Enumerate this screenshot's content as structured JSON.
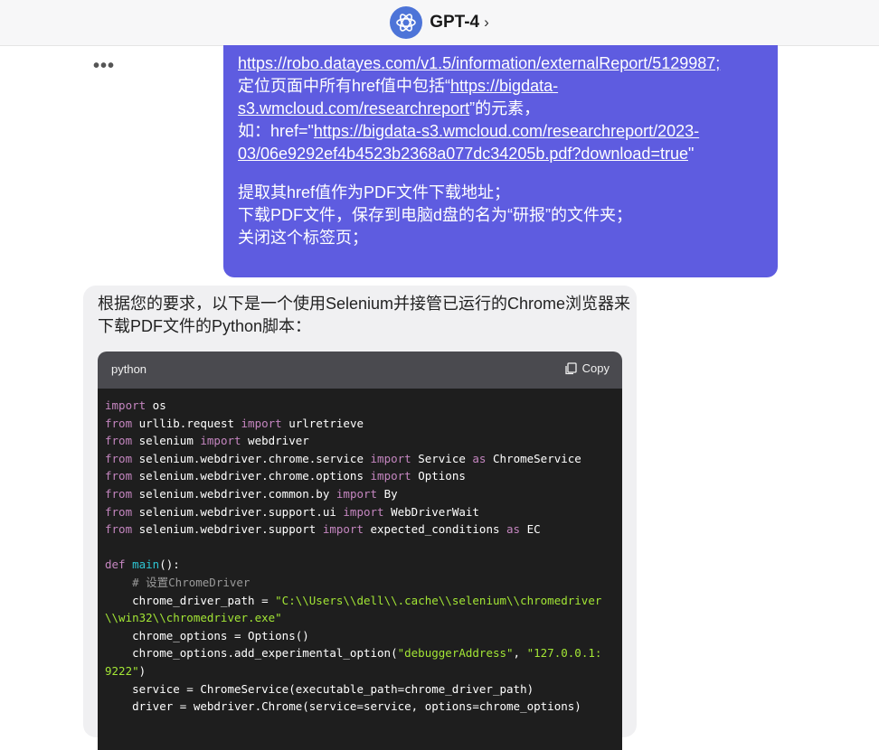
{
  "header": {
    "title": "GPT-4",
    "chevron": "›"
  },
  "more_dots": "•••",
  "user_message": {
    "line1": "https://robo.datayes.com/v1.5/information/externalReport/5129987;",
    "line2_prefix": "定位页面中所有href值中包括“",
    "line2_link": "https://bigdata-s3.wmcloud.com/researchreport",
    "line2_suffix": "”的元素，",
    "line3_prefix": "如：href=\"",
    "line3_link": "https://bigdata-s3.wmcloud.com/researchreport/2023-03/06e9292ef4b4523b2368a077dc34205b.pdf?download=true",
    "line3_suffix": "\"",
    "line4": "提取其href值作为PDF文件下载地址；",
    "line5": "下载PDF文件，保存到电脑d盘的名为“研报”的文件夹；",
    "line6": "关闭这个标签页；"
  },
  "assistant": {
    "intro": "根据您的要求，以下是一个使用Selenium并接管已运行的Chrome浏览器来下载PDF文件的Python脚本：",
    "code_lang": "python",
    "copy_label": "Copy"
  },
  "code": {
    "l1a": "import",
    "l1b": " os",
    "l2a": "from",
    "l2b": " urllib.request ",
    "l2c": "import",
    "l2d": " urlretrieve",
    "l3a": "from",
    "l3b": " selenium ",
    "l3c": "import",
    "l3d": " webdriver",
    "l4a": "from",
    "l4b": " selenium.webdriver.chrome.service ",
    "l4c": "import",
    "l4d": " Service ",
    "l4e": "as",
    "l4f": " ChromeService",
    "l5a": "from",
    "l5b": " selenium.webdriver.chrome.options ",
    "l5c": "import",
    "l5d": " Options",
    "l6a": "from",
    "l6b": " selenium.webdriver.common.by ",
    "l6c": "import",
    "l6d": " By",
    "l7a": "from",
    "l7b": " selenium.webdriver.support.ui ",
    "l7c": "import",
    "l7d": " WebDriverWait",
    "l8a": "from",
    "l8b": " selenium.webdriver.support ",
    "l8c": "import",
    "l8d": " expected_conditions ",
    "l8e": "as",
    "l8f": " EC",
    "l10a": "def",
    "l10b": " main",
    "l10c": "():",
    "l11": "    # 设置ChromeDriver",
    "l12a": "    chrome_driver_path = ",
    "l12b": "\"C:\\\\Users\\\\dell\\\\.cache\\\\selenium\\\\chromedriver",
    "l13": "\\\\win32\\\\chromedriver.exe\"",
    "l14": "    chrome_options = Options()",
    "l15a": "    chrome_options.add_experimental_option(",
    "l15b": "\"debuggerAddress\"",
    "l15c": ", ",
    "l15d": "\"127.0.0.1:",
    "l16a": "9222\"",
    "l16b": ")",
    "l17": "    service = ChromeService(executable_path=chrome_driver_path)",
    "l18": "    driver = webdriver.Chrome(service=service, options=chrome_options)"
  },
  "colors": {
    "keyword": "#c586c0",
    "function": "#2ec5d3",
    "string": "#a3e635",
    "comment": "#9a9a9a",
    "bubble": "#5e5ce0"
  }
}
